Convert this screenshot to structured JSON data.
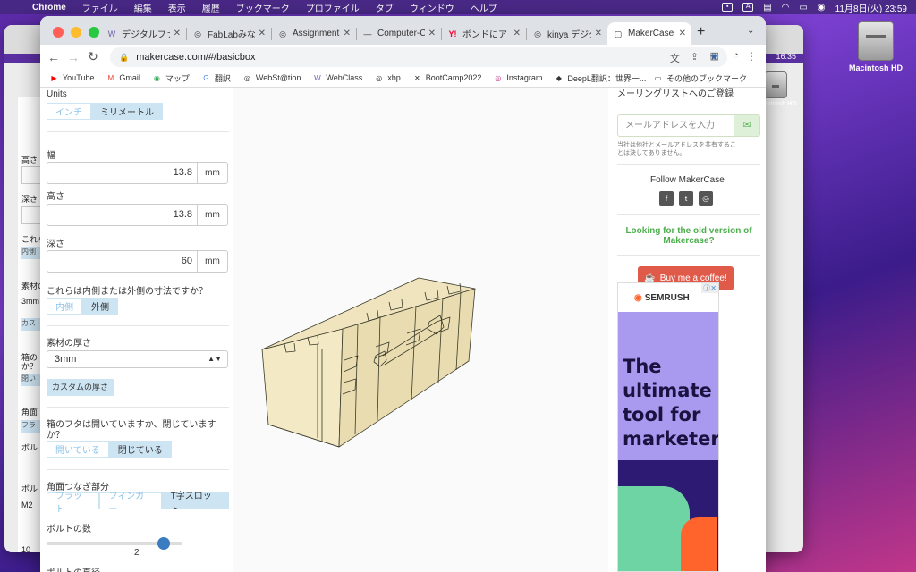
{
  "menubar": {
    "app": "Chrome",
    "items": [
      "ファイル",
      "編集",
      "表示",
      "履歴",
      "ブックマーク",
      "プロファイル",
      "タブ",
      "ウィンドウ",
      "ヘルプ"
    ],
    "datetime": "11月8日(火)  23:59",
    "status_a": "A"
  },
  "background_window": {
    "time": "16:35",
    "fragments": [
      "高さ",
      "深さ",
      "これら",
      "内側",
      "素材の",
      "3mm",
      "カス",
      "箱の",
      "か？",
      "閉い",
      "角面",
      "フラ",
      "ボルト",
      "ボルト",
      "M2",
      "10"
    ]
  },
  "desktop": {
    "hdd_label": "Macintosh HD",
    "hdd_label_small": "Macintosh HD"
  },
  "tabs": [
    {
      "label": "デジタルファ",
      "icon": "W"
    },
    {
      "label": "FabLabみな",
      "icon": "◎"
    },
    {
      "label": "Assignment",
      "icon": "◎"
    },
    {
      "label": "Computer-C",
      "icon": "—"
    },
    {
      "label": "ボンドにア",
      "icon": "Y!"
    },
    {
      "label": "kinya デジタ",
      "icon": "◎"
    },
    {
      "label": "MakerCase",
      "icon": "▢"
    }
  ],
  "address": {
    "url": "makercase.com/#/basicbox"
  },
  "bookmarks": [
    {
      "label": "YouTube",
      "icon": "▶",
      "color": "#ff0000"
    },
    {
      "label": "Gmail",
      "icon": "M",
      "color": "#ea4335"
    },
    {
      "label": "マップ",
      "icon": "◉",
      "color": "#34a853"
    },
    {
      "label": "翻訳",
      "icon": "G",
      "color": "#4285f4"
    },
    {
      "label": "WebSt@tion",
      "icon": "◎",
      "color": "#555555"
    },
    {
      "label": "WebClass",
      "icon": "W",
      "color": "#6b5aa8"
    },
    {
      "label": "xbp",
      "icon": "◎",
      "color": "#555555"
    },
    {
      "label": "BootCamp2022",
      "icon": "✕",
      "color": "#111111"
    },
    {
      "label": "Instagram",
      "icon": "◎",
      "color": "#c13584"
    },
    {
      "label": "DeepL翻訳：世界一...",
      "icon": "◆",
      "color": "#0f2b46"
    }
  ],
  "bookmarks_other": "その他のブックマーク",
  "form": {
    "units_label": "Units",
    "units_options": [
      "インチ",
      "ミリメートル"
    ],
    "units_selected": 1,
    "width_label": "幅",
    "width_value": "13.8",
    "height_label": "高さ",
    "height_value": "13.8",
    "depth_label": "深さ",
    "depth_value": "60",
    "unit": "mm",
    "dim_question": "これらは内側または外側の寸法ですか？",
    "dim_options": [
      "内側",
      "外側"
    ],
    "dim_selected": 1,
    "thickness_label": "素材の厚さ",
    "thickness_value": "3mm",
    "custom_thickness": "カスタムの厚さ",
    "lid_question": "箱のフタは開いていますか、閉じています",
    "lid_question_2": "か？",
    "lid_options": [
      "開いている",
      "閉じている"
    ],
    "lid_selected": 1,
    "joint_label": "角面つなぎ部分",
    "joint_options": [
      "フラット",
      "フィンガー",
      "T字スロット"
    ],
    "joint_selected": 2,
    "bolts_label": "ボルトの数",
    "bolts_value": "2",
    "bolts_fraction": 0.86,
    "bolt_diameter_label": "ボルトの直径"
  },
  "sidebar": {
    "mailing_title": "メーリングリストへのご登録",
    "email_placeholder": "メールアドレスを入力",
    "privacy": "当社は他社とメールアドレスを共有するこ",
    "privacy_2": "とは決してありません。",
    "follow": "Follow MakerCase",
    "old_version": "Looking for the old version of",
    "old_version_2": "Makercase?",
    "coffee": "Buy me a coffee!"
  },
  "ad": {
    "brand": "SEMRUSH",
    "headline": [
      "The",
      "ultimate",
      "tool for",
      "marketers"
    ]
  },
  "colors": {
    "accent_blue": "#cde4f2",
    "link_green": "#4cae4c",
    "coffee_red": "#e05a4a",
    "box_fill": "#f3e9c4"
  }
}
